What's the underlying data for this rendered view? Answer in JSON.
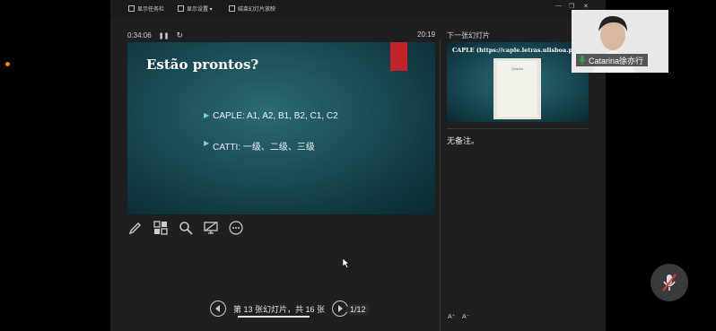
{
  "toolbar": {
    "show_taskbar": "显示任务栏",
    "display_settings": "显示设置 ▾",
    "end_slideshow": "结束幻灯片放映"
  },
  "presenter": {
    "elapsed_time": "0:34:06",
    "clock": "20:19",
    "current_slide": {
      "title": "Estão prontos?",
      "bullets": [
        "CAPLE: A1, A2, B1, B2, C1, C2",
        "CATTI: 一级、二级、三级"
      ]
    },
    "next_label": "下一张幻灯片",
    "next_slide": {
      "title": "CAPLE (https://caple.letras.ulisboa.pt/)",
      "book_text": "Quadro"
    },
    "notes": "无备注。",
    "slide_counter": "第 13 张幻灯片，共 16 张",
    "overlay_counter": "1/12",
    "font_increase": "A⁺",
    "font_decrease": "A⁻"
  },
  "participant": {
    "name": "Catarina徐亦行"
  },
  "colors": {
    "accent_red": "#c4232b",
    "mic_green": "#2bb24c",
    "status_dot": "#f08a00"
  }
}
